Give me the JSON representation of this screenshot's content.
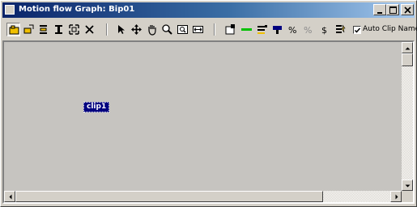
{
  "window": {
    "title": "Motion flow Graph: Bip01",
    "caption_buttons": [
      "minimize-icon",
      "maximize-icon",
      "close-icon"
    ]
  },
  "toolbar": {
    "left_group": [
      "create-clips-icon",
      "create-transition-icon",
      "select-clips-icon",
      "select-transition-icon",
      "fit-selection-icon",
      "delete-icon"
    ],
    "middle_group": [
      "select-arrow-icon",
      "move-icon",
      "pan-hand-icon",
      "zoom-icon",
      "zoom-region-icon",
      "zoom-extents-icon"
    ],
    "right_group": [
      "show-scripts-icon",
      "define-script-icon",
      "script-list-icon",
      "start-clip-icon",
      "random-icon",
      "transition-icon",
      "dollar-icon",
      "save-script-icon"
    ],
    "auto_clip_names": {
      "label": "Auto Clip Names",
      "checked": true
    }
  },
  "canvas": {
    "clips": [
      {
        "label": "clip1",
        "selected": true
      }
    ]
  },
  "colors": {
    "title_gradient_start": "#0a246a",
    "title_gradient_end": "#a6caf0",
    "canvas_background": "#c6c4c0",
    "clip_fill": "#00007f"
  }
}
